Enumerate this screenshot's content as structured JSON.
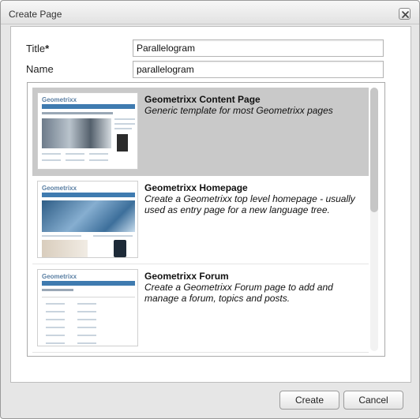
{
  "dialog": {
    "title": "Create Page",
    "close_icon": "close-icon"
  },
  "form": {
    "title_label": "Title",
    "title_required_mark": "*",
    "title_value": "Parallelogram",
    "name_label": "Name",
    "name_value": "parallelogram"
  },
  "templates": [
    {
      "title": "Geometrixx Content Page",
      "description": "Generic template for most Geometrixx pages",
      "selected": true,
      "thumb_logo": "Geometrixx"
    },
    {
      "title": "Geometrixx Homepage",
      "description": "Create a Geometrixx top level homepage - usually used as entry page for a new language tree.",
      "selected": false,
      "thumb_logo": "Geometrixx"
    },
    {
      "title": "Geometrixx Forum",
      "description": "Create a Geometrixx Forum page to add and manage a forum, topics and posts.",
      "selected": false,
      "thumb_logo": "Geometrixx"
    }
  ],
  "buttons": {
    "create": "Create",
    "cancel": "Cancel"
  },
  "colors": {
    "selected_row": "#c9c9c9",
    "nav_bar": "#3f7bb0"
  }
}
